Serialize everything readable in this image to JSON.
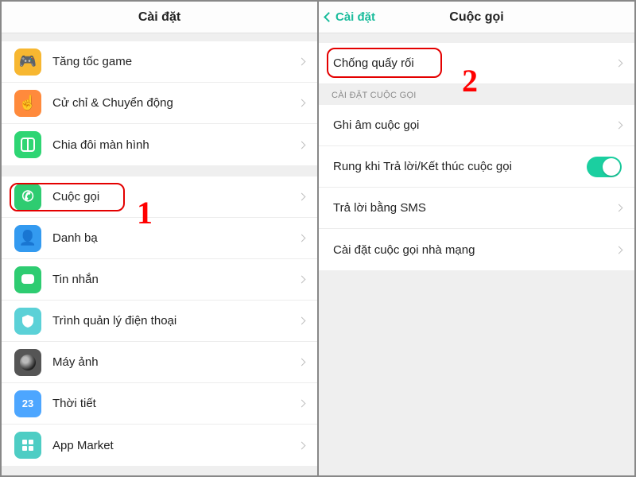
{
  "left": {
    "title": "Cài đặt",
    "group1": [
      {
        "label": "Tăng tốc game",
        "icon": "game"
      },
      {
        "label": "Cử chỉ & Chuyển động",
        "icon": "gesture"
      },
      {
        "label": "Chia đôi màn hình",
        "icon": "split"
      }
    ],
    "group2": [
      {
        "label": "Cuộc gọi",
        "icon": "call"
      },
      {
        "label": "Danh bạ",
        "icon": "contacts"
      },
      {
        "label": "Tin nhắn",
        "icon": "message"
      },
      {
        "label": "Trình quản lý điện thoại",
        "icon": "phonemgr"
      },
      {
        "label": "Máy ảnh",
        "icon": "camera"
      },
      {
        "label": "Thời tiết",
        "icon": "weather",
        "weatherText": "23"
      },
      {
        "label": "App Market",
        "icon": "market"
      }
    ],
    "annotation": "1"
  },
  "right": {
    "backLabel": "Cài đặt",
    "title": "Cuộc gọi",
    "top": {
      "label": "Chống quấy rối"
    },
    "sectionHeader": "CÀI ĐẶT CUỘC GỌI",
    "rows": [
      {
        "label": "Ghi âm cuộc gọi",
        "type": "chevron"
      },
      {
        "label": "Rung khi Trả lời/Kết thúc cuộc gọi",
        "type": "toggle",
        "on": true
      },
      {
        "label": "Trả lời bằng SMS",
        "type": "chevron"
      },
      {
        "label": "Cài đặt cuộc gọi nhà mạng",
        "type": "chevron"
      }
    ],
    "annotation": "2"
  }
}
